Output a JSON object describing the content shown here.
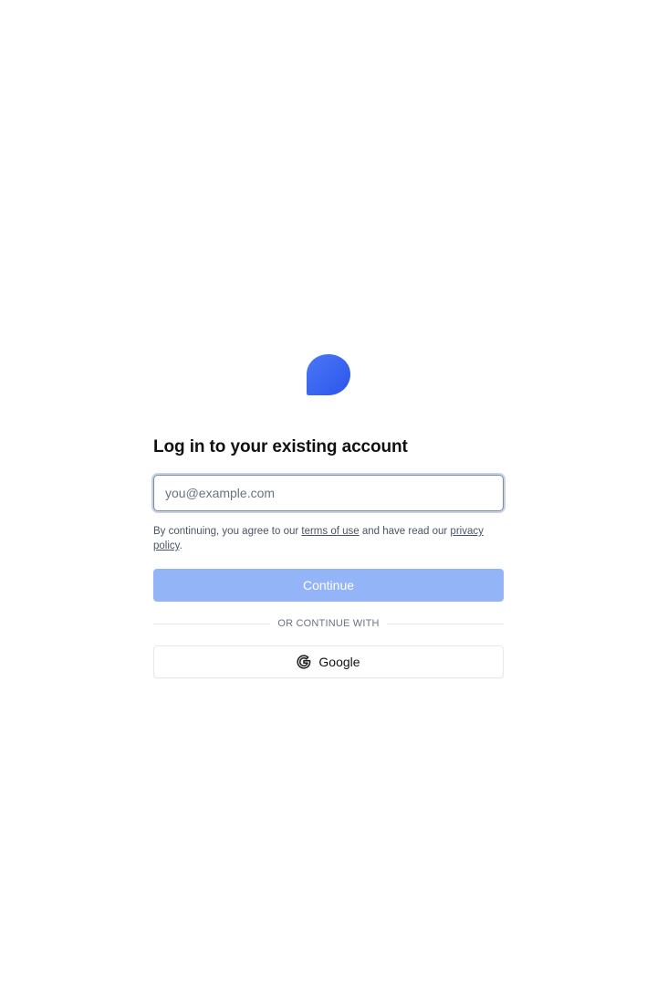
{
  "logo": {
    "icon": "chat-bubble-icon",
    "color": "#3563f1"
  },
  "login": {
    "title": "Log in to your existing account",
    "email_placeholder": "you@example.com",
    "email_value": "",
    "terms_prefix": "By continuing, you agree to our ",
    "terms_link": "terms of use",
    "terms_middle": " and have read our ",
    "privacy_link": "privacy policy",
    "terms_suffix": ".",
    "continue_label": "Continue",
    "divider_label": "OR CONTINUE WITH",
    "google_label": "Google",
    "google_icon": "google-g-icon"
  },
  "colors": {
    "continue_bg_disabled": "#93b4f6",
    "focus_ring": "#c9d3e6"
  }
}
